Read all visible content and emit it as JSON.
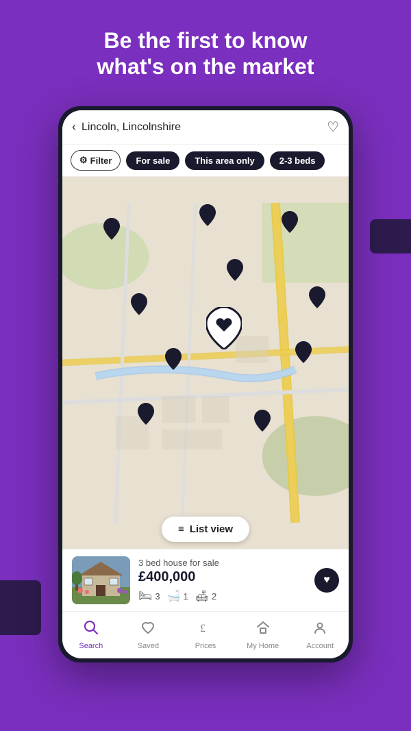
{
  "headline": {
    "line1": "Be the first to know",
    "line2": "what's on the market"
  },
  "searchbar": {
    "location": "Lincoln, Lincolnshire",
    "back_icon": "‹",
    "heart_icon": "♡"
  },
  "filters": {
    "filter_label": "Filter",
    "filter_icon": "⟨⟩",
    "chips": [
      "For sale",
      "This area only",
      "2-3 beds"
    ]
  },
  "map": {
    "list_view_label": "List view",
    "list_icon": "≡"
  },
  "property": {
    "title": "3 bed house for sale",
    "price": "£400,000",
    "beds": "3",
    "baths": "1",
    "sofas": "2",
    "fav_icon": "♥"
  },
  "nav": {
    "items": [
      {
        "id": "search",
        "label": "Search",
        "icon": "🔍",
        "active": true
      },
      {
        "id": "saved",
        "label": "Saved",
        "icon": "♡",
        "active": false
      },
      {
        "id": "prices",
        "label": "Prices",
        "icon": "£",
        "active": false
      },
      {
        "id": "myhome",
        "label": "My Home",
        "icon": "⌂",
        "active": false
      },
      {
        "id": "account",
        "label": "Account",
        "icon": "◯",
        "active": false
      }
    ]
  },
  "colors": {
    "purple": "#7B2FBE",
    "dark": "#1a1a2e"
  }
}
